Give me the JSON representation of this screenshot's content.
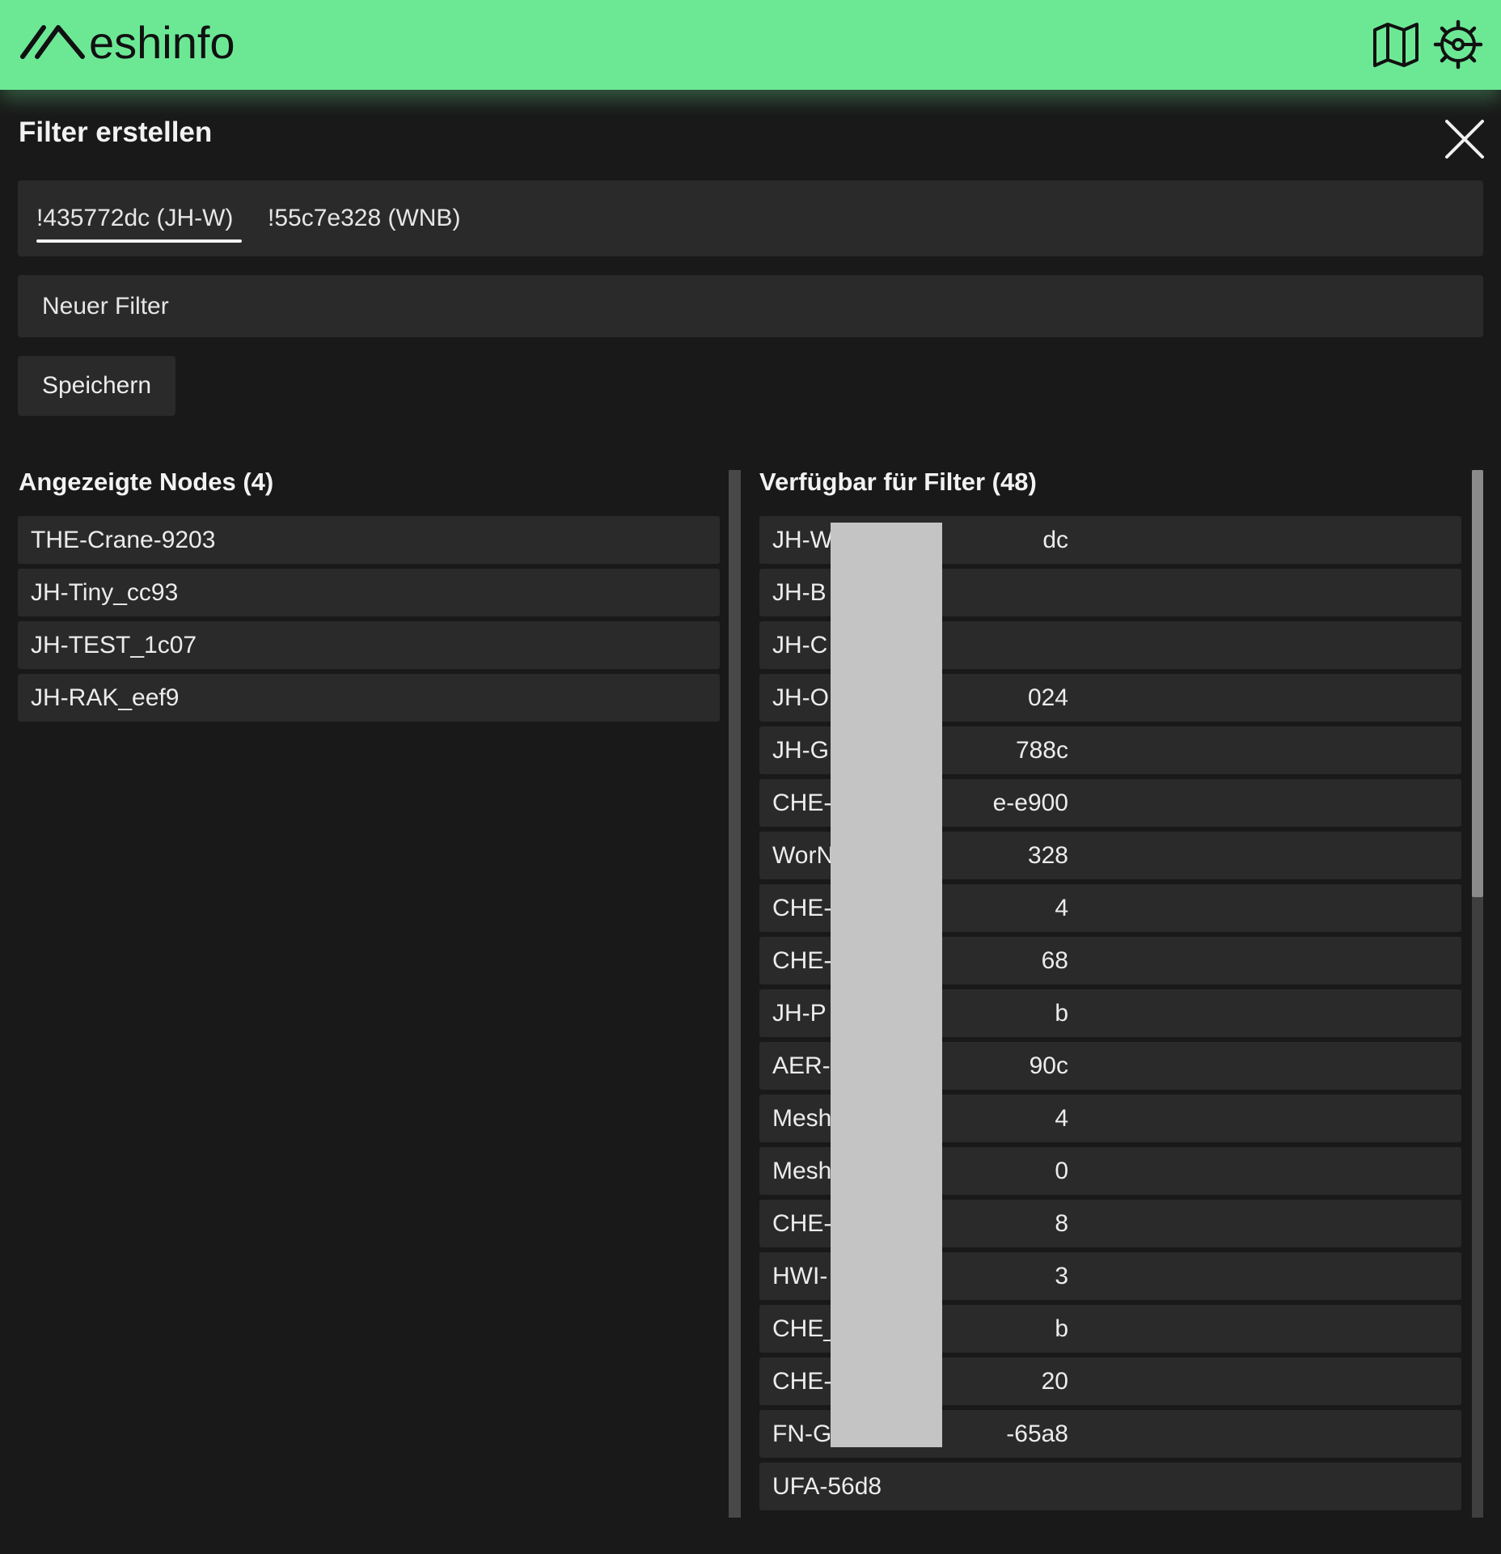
{
  "app": {
    "name": "eshinfo"
  },
  "topbar": {
    "map_icon": "map-icon",
    "settings_icon": "gear-icon"
  },
  "panel": {
    "title": "Filter erstellen",
    "close_icon": "close-icon"
  },
  "tabs": [
    {
      "label": "!435772dc (JH-W)",
      "active": true
    },
    {
      "label": "!55c7e328 (WNB)",
      "active": false
    }
  ],
  "filter_name": {
    "value": "",
    "placeholder": "Neuer Filter"
  },
  "save_label": "Speichern",
  "displayed": {
    "title": "Angezeigte Nodes (4)",
    "items": [
      "THE-Crane-9203",
      "JH-Tiny_cc93",
      "JH-TEST_1c07",
      "JH-RAK_eef9"
    ]
  },
  "available": {
    "title": "Verfügbar für Filter (48)",
    "items": [
      "JH-W",
      "JH-B",
      "JH-C",
      "JH-O",
      "JH-G",
      "CHE-",
      "WorN",
      "CHE-",
      "CHE-",
      "JH-P",
      "AER-",
      "Mesh",
      "Mesh",
      "CHE-",
      "HWI-",
      "CHE_",
      "CHE-",
      "FN-G",
      "UFA-56d8"
    ],
    "items_after_redaction": [
      "dc",
      "",
      "",
      "024",
      "788c",
      "e-e900",
      "328",
      "4",
      "68",
      "b",
      "90c",
      "4",
      "0",
      "8",
      "3",
      "b",
      "20",
      "-65a8",
      ""
    ]
  },
  "colors": {
    "topbar": "#6ce895",
    "background": "#191919",
    "surface": "#2a2a2a",
    "redaction": "#c4c4c4"
  }
}
